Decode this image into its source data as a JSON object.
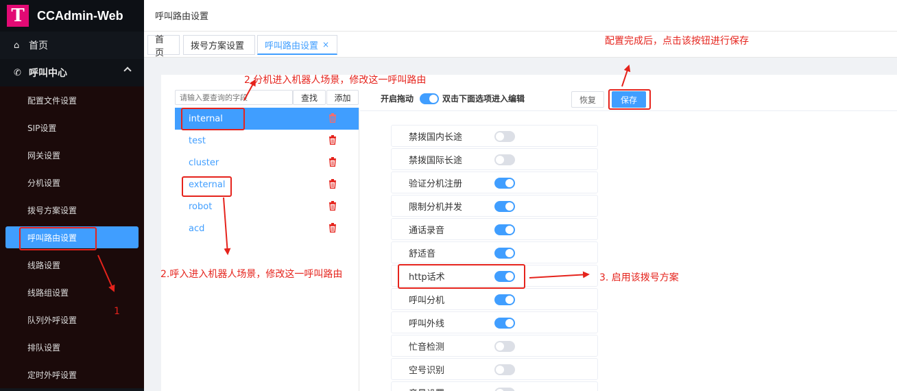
{
  "brand": {
    "logo_letter": "T",
    "name": "CCAdmin-Web",
    "logo_color": "#e20a74"
  },
  "sidebar": {
    "home": "首页",
    "callcenter": "呼叫中心",
    "items": [
      "配置文件设置",
      "SIP设置",
      "网关设置",
      "分机设置",
      "拨号方案设置",
      "呼叫路由设置",
      "线路设置",
      "线路组设置",
      "队列外呼设置",
      "排队设置",
      "定时外呼设置"
    ],
    "active_index": 5
  },
  "header": {
    "title": "呼叫路由设置"
  },
  "tabs": [
    {
      "label": "首页"
    },
    {
      "label": "拨号方案设置"
    },
    {
      "label": "呼叫路由设置",
      "close": "×"
    }
  ],
  "search": {
    "placeholder": "请输入要查询的字段",
    "search_label": "查找",
    "add_label": "添加"
  },
  "routes": [
    "internal",
    "test",
    "cluster",
    "external",
    "robot",
    "acd"
  ],
  "toolbar": {
    "drag_label": "开启拖动",
    "drag_hint": "双击下面选项进入编辑",
    "restore_label": "恢复",
    "save_label": "保存"
  },
  "options": [
    {
      "label": "禁拨国内长途",
      "on": false
    },
    {
      "label": "禁拨国际长途",
      "on": false
    },
    {
      "label": "验证分机注册",
      "on": true
    },
    {
      "label": "限制分机并发",
      "on": true
    },
    {
      "label": "通话录音",
      "on": true
    },
    {
      "label": "舒适音",
      "on": true
    },
    {
      "label": "http话术",
      "on": true
    },
    {
      "label": "呼叫分机",
      "on": true
    },
    {
      "label": "呼叫外线",
      "on": true
    },
    {
      "label": "忙音检测",
      "on": false
    },
    {
      "label": "空号识别",
      "on": false
    },
    {
      "label": "音量设置",
      "on": false
    }
  ],
  "annotations": {
    "a1": "1",
    "a2_top": "2.分机进入机器人场景，修改这一呼叫路由",
    "a2_bottom": "2.呼入进入机器人场景，修改这一呼叫路由",
    "a3": "3. 启用该拨号方案",
    "save_note": "配置完成后，点击该按钮进行保存"
  },
  "colors": {
    "accent": "#409eff",
    "annotation": "#e5231c",
    "sidebar_bg": "#12161c"
  }
}
